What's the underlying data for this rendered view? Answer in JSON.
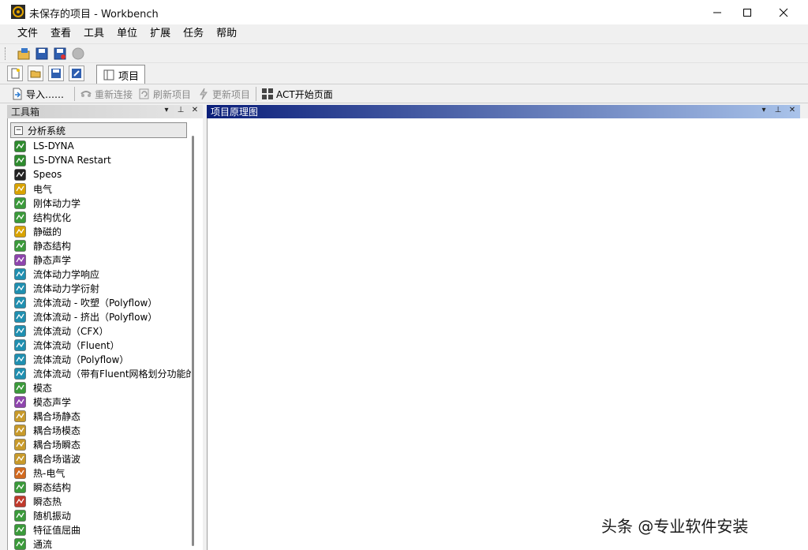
{
  "window": {
    "title": "未保存的项目 - Workbench"
  },
  "menu": [
    "文件",
    "查看",
    "工具",
    "单位",
    "扩展",
    "任务",
    "帮助"
  ],
  "tabs": {
    "project": "项目"
  },
  "toolbar": {
    "import": "导入……",
    "reconnect": "重新连接",
    "refresh": "刷新项目",
    "update": "更新项目",
    "act": "ACT开始页面"
  },
  "toolbox": {
    "title": "工具箱",
    "group": "分析系统",
    "items": [
      {
        "label": "LS-DYNA",
        "icon": "lsdyna-icon",
        "color": "#2e8b2e"
      },
      {
        "label": "LS-DYNA Restart",
        "icon": "lsdyna-restart-icon",
        "color": "#2e8b2e"
      },
      {
        "label": "Speos",
        "icon": "speos-icon",
        "color": "#222222"
      },
      {
        "label": "电气",
        "icon": "electric-icon",
        "color": "#d9a300"
      },
      {
        "label": "刚体动力学",
        "icon": "rigid-dynamics-icon",
        "color": "#3a9a3a"
      },
      {
        "label": "结构优化",
        "icon": "topology-opt-icon",
        "color": "#3a9a3a"
      },
      {
        "label": "静磁的",
        "icon": "magnetostatic-icon",
        "color": "#d9a300"
      },
      {
        "label": "静态结构",
        "icon": "static-structural-icon",
        "color": "#3a9a3a"
      },
      {
        "label": "静态声学",
        "icon": "static-acoustics-icon",
        "color": "#8e44ad"
      },
      {
        "label": "流体动力学响应",
        "icon": "hydro-response-icon",
        "color": "#1f8fb0"
      },
      {
        "label": "流体动力学衍射",
        "icon": "hydro-diffraction-icon",
        "color": "#1f8fb0"
      },
      {
        "label": "流体流动 - 吹塑（Polyflow）",
        "icon": "polyflow-blow-icon",
        "color": "#1f8fb0"
      },
      {
        "label": "流体流动 - 挤出（Polyflow）",
        "icon": "polyflow-extrusion-icon",
        "color": "#1f8fb0"
      },
      {
        "label": "流体流动（CFX）",
        "icon": "cfx-icon",
        "color": "#1f8fb0"
      },
      {
        "label": "流体流动（Fluent）",
        "icon": "fluent-icon",
        "color": "#1f8fb0"
      },
      {
        "label": "流体流动（Polyflow）",
        "icon": "polyflow-icon",
        "color": "#1f8fb0"
      },
      {
        "label": "流体流动（带有Fluent网格划分功能的",
        "icon": "fluent-meshing-icon",
        "color": "#1f8fb0"
      },
      {
        "label": "模态",
        "icon": "modal-icon",
        "color": "#3a9a3a"
      },
      {
        "label": "模态声学",
        "icon": "modal-acoustics-icon",
        "color": "#8e44ad"
      },
      {
        "label": "耦合场静态",
        "icon": "coupled-static-icon",
        "color": "#c89a2a"
      },
      {
        "label": "耦合场模态",
        "icon": "coupled-modal-icon",
        "color": "#c89a2a"
      },
      {
        "label": "耦合场瞬态",
        "icon": "coupled-transient-icon",
        "color": "#c89a2a"
      },
      {
        "label": "耦合场谐波",
        "icon": "coupled-harmonic-icon",
        "color": "#c89a2a"
      },
      {
        "label": "热-电气",
        "icon": "thermal-electric-icon",
        "color": "#d2691e"
      },
      {
        "label": "瞬态结构",
        "icon": "transient-structural-icon",
        "color": "#3a9a3a"
      },
      {
        "label": "瞬态热",
        "icon": "transient-thermal-icon",
        "color": "#c0392b"
      },
      {
        "label": "随机振动",
        "icon": "random-vibration-icon",
        "color": "#3a9a3a"
      },
      {
        "label": "特征值屈曲",
        "icon": "eigenvalue-buckling-icon",
        "color": "#3a9a3a"
      },
      {
        "label": "通流",
        "icon": "throughflow-icon",
        "color": "#3a9a3a"
      }
    ]
  },
  "schematic": {
    "title": "项目原理图"
  },
  "watermark": "头条 @专业软件安装"
}
